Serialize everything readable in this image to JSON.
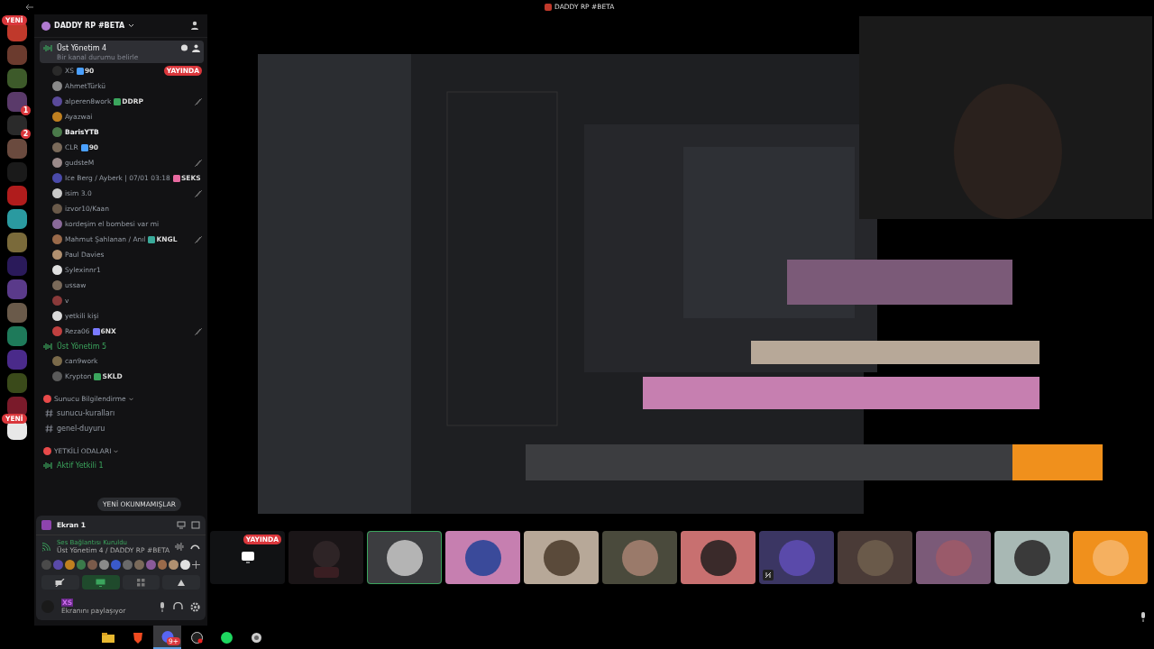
{
  "window": {
    "title": "DADDY RP #BETA"
  },
  "servers": [
    {
      "color": "#c0392b",
      "badge": "YENİ"
    },
    {
      "color": "#6b3b2e"
    },
    {
      "color": "#3d5a2a"
    },
    {
      "color": "#5a3a6a",
      "badge": "1"
    },
    {
      "color": "#2a2a2a",
      "badge": "2"
    },
    {
      "color": "#6a4a3e"
    },
    {
      "color": "#1a1a1a"
    },
    {
      "color": "#b01c1c"
    },
    {
      "color": "#2a9aa0"
    },
    {
      "color": "#7a6a3a"
    },
    {
      "color": "#2a1a5a"
    },
    {
      "color": "#5a3a8a"
    },
    {
      "color": "#6a5a4a"
    },
    {
      "color": "#1e7a5a"
    },
    {
      "color": "#4a2a8a"
    },
    {
      "color": "#3a4a1a"
    },
    {
      "color": "#7a1a2a"
    },
    {
      "color": "#e8e8e8",
      "badge": "YENİ"
    }
  ],
  "server": {
    "name": "DADDY RP #BETA"
  },
  "channels": [
    {
      "kind": "voice",
      "name": "Üst Yönetim 4",
      "selected": true,
      "status": "Bir kanal durumu belirle",
      "members": [
        {
          "name": "XS",
          "tag": {
            "text": "90",
            "color": "#4aa0ff"
          },
          "live": "YAYINDA",
          "muted": false,
          "speaking": false,
          "color": "#2a2a2a"
        },
        {
          "name": "AhmetTürkü",
          "muted": false,
          "speaking": false,
          "color": "#8a8a8a"
        },
        {
          "name": "alperen8work",
          "tag": {
            "text": "DDRP",
            "color": "#3ba55d"
          },
          "muted": true,
          "speaking": false,
          "color": "#5a4a9a"
        },
        {
          "name": "Ayazwai",
          "muted": false,
          "speaking": false,
          "color": "#c08020"
        },
        {
          "name": "BarisYTB",
          "muted": false,
          "speaking": true,
          "color": "#4a7a4a"
        },
        {
          "name": "CLR",
          "tag": {
            "text": "90",
            "color": "#4aa0ff"
          },
          "muted": false,
          "speaking": false,
          "color": "#7a6a5a"
        },
        {
          "name": "gudsteM",
          "muted": true,
          "speaking": false,
          "color": "#9a8a8a"
        },
        {
          "name": "Ice Berg / Ayberk | 07/01 03:18",
          "tag": {
            "text": "SEKS",
            "color": "#e86aa0"
          },
          "muted": false,
          "speaking": false,
          "color": "#4a4aaa"
        },
        {
          "name": "isim 3.0",
          "muted": true,
          "speaking": false,
          "color": "#c8c8c8"
        },
        {
          "name": "izvor10/Kaan",
          "muted": false,
          "speaking": false,
          "color": "#6a5a4a"
        },
        {
          "name": "kordeşim el bombesi var mi",
          "muted": false,
          "speaking": false,
          "color": "#8a6a9a"
        },
        {
          "name": "Mahmut Şahlanan / Anıl",
          "tag": {
            "text": "KNGL",
            "color": "#3aaa9a"
          },
          "muted": true,
          "speaking": false,
          "color": "#9a6a4a"
        },
        {
          "name": "Paul Davies",
          "muted": false,
          "speaking": false,
          "color": "#b09070"
        },
        {
          "name": "Sylexinnr1",
          "muted": false,
          "speaking": false,
          "color": "#e0e0e0"
        },
        {
          "name": "ussaw",
          "muted": false,
          "speaking": false,
          "color": "#7a6a5a"
        },
        {
          "name": "v",
          "muted": false,
          "speaking": false,
          "color": "#8a3a3a"
        },
        {
          "name": "yetkili kişi",
          "muted": false,
          "speaking": false,
          "color": "#dadada"
        },
        {
          "name": "Reza06",
          "tag": {
            "text": "6NX",
            "color": "#7a7aff"
          },
          "muted": true,
          "speaking": false,
          "color": "#c04040"
        }
      ]
    },
    {
      "kind": "voice",
      "name": "Üst Yönetim 5",
      "selected": false,
      "members": [
        {
          "name": "can9work",
          "muted": false,
          "speaking": false,
          "color": "#7a6a4a"
        },
        {
          "name": "Krypton",
          "tag": {
            "text": "SKLD",
            "color": "#3ba55d"
          },
          "muted": false,
          "speaking": false,
          "color": "#5a5a5a"
        }
      ]
    },
    {
      "kind": "category",
      "name": "Sunucu Bilgilendirme",
      "color": "#e84a4a"
    },
    {
      "kind": "text",
      "name": "sunucu-kuralları"
    },
    {
      "kind": "text",
      "name": "genel-duyuru"
    },
    {
      "kind": "category",
      "name": "YETKİLİ ODALARI",
      "color": "#e84a4a"
    },
    {
      "kind": "voice",
      "name": "Aktif Yetkili 1",
      "selected": false
    }
  ],
  "unread_pill": "YENİ OKUNMAMIŞLAR",
  "stream_bar": {
    "title": "Ekran 1"
  },
  "voice_panel": {
    "status": "Ses Bağlantısı Kuruldu",
    "location": "Üst Yönetim 4 / DADDY RP #BETA",
    "avatars": [
      {
        "color": "#4a4a4a"
      },
      {
        "color": "#5a4aaa"
      },
      {
        "color": "#c08020"
      },
      {
        "color": "#3a7a4a"
      },
      {
        "color": "#7a5a4a"
      },
      {
        "color": "#8a8a8a"
      },
      {
        "color": "#3a5aca"
      },
      {
        "color": "#6a6a6a"
      },
      {
        "color": "#7a6a5a"
      },
      {
        "color": "#8a5a9a"
      },
      {
        "color": "#9a6a4a"
      },
      {
        "color": "#b09070"
      },
      {
        "color": "#e0e0e0"
      }
    ],
    "buttons": [
      {
        "kind": "camera",
        "selected": false
      },
      {
        "kind": "screen",
        "selected": true
      },
      {
        "kind": "activity",
        "selected": false
      },
      {
        "kind": "soundboard",
        "selected": false
      }
    ]
  },
  "user": {
    "name": "XS",
    "status": "Ekranını paylaşıyor"
  },
  "stage": {
    "tiles": [
      {
        "kind": "screen",
        "badge": "YAYINDA",
        "color": "#111214",
        "selected": false,
        "muted": false
      },
      {
        "kind": "camera",
        "color": "#1a1517",
        "selected": false,
        "muted": false
      },
      {
        "kind": "avatar",
        "color": "#3c3d40",
        "avatar": {
          "color": "#b4b4b4"
        },
        "selected": true,
        "muted": false
      },
      {
        "kind": "avatar",
        "color": "#c67fb0",
        "avatar": {
          "color": "#3a4a9a"
        },
        "selected": false,
        "muted": false
      },
      {
        "kind": "avatar",
        "color": "#b7a898",
        "avatar": {
          "color": "#5a4a3a"
        },
        "selected": false,
        "muted": false
      },
      {
        "kind": "avatar",
        "color": "#4a4a3c",
        "avatar": {
          "color": "#9a7a6a"
        },
        "selected": false,
        "muted": false
      },
      {
        "kind": "avatar",
        "color": "#c87070",
        "avatar": {
          "color": "#3a2a2a"
        },
        "selected": false,
        "muted": false
      },
      {
        "kind": "avatar",
        "color": "#3b3663",
        "avatar": {
          "color": "#5a4aaa"
        },
        "selected": false,
        "muted": true
      },
      {
        "kind": "avatar",
        "color": "#4a3b37",
        "avatar": {
          "color": "#6a5a4a"
        },
        "selected": false,
        "muted": false
      },
      {
        "kind": "avatar",
        "color": "#7b5a78",
        "avatar": {
          "color": "#9a5a6a"
        },
        "selected": false,
        "muted": false
      },
      {
        "kind": "avatar",
        "color": "#a8b8b4",
        "avatar": {
          "color": "#3a3a3a"
        },
        "selected": false,
        "muted": false
      },
      {
        "kind": "avatar",
        "color": "#f0901c",
        "avatar": {
          "color": "#f5b060"
        },
        "selected": false,
        "muted": false
      }
    ]
  },
  "taskbar": [
    {
      "kind": "folder",
      "active": false
    },
    {
      "kind": "brave",
      "active": false
    },
    {
      "kind": "discord",
      "active": true,
      "badge": "9+"
    },
    {
      "kind": "obs",
      "active": false
    },
    {
      "kind": "spotify",
      "active": false
    },
    {
      "kind": "app",
      "active": false
    }
  ]
}
